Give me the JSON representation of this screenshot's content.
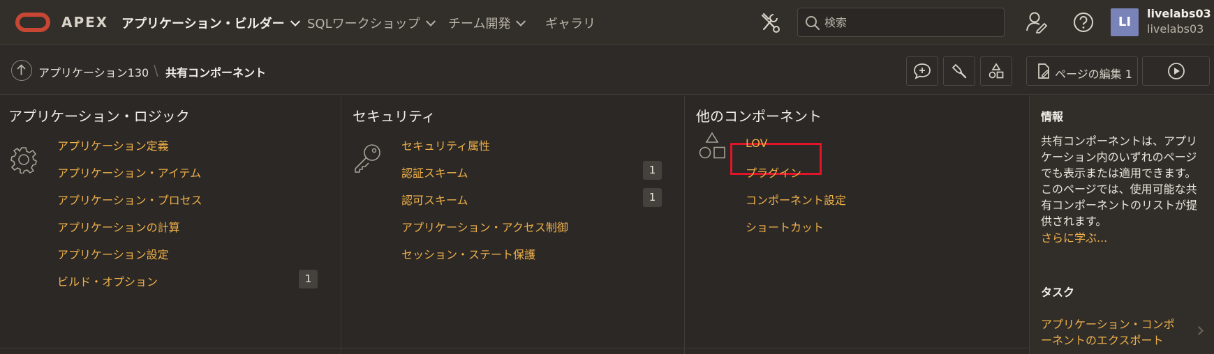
{
  "header": {
    "brand": "APEX",
    "menu": [
      {
        "label": "アプリケーション・ビルダー",
        "active": true
      },
      {
        "label": "SQLワークショップ",
        "active": false
      },
      {
        "label": "チーム開発",
        "active": false
      },
      {
        "label": "ギャラリ",
        "active": false
      }
    ],
    "search_placeholder": "検索",
    "user_initials": "LI",
    "user_name": "livelabs03",
    "user_workspace": "livelabs03"
  },
  "breadcrumb": {
    "parent": "アプリケーション130",
    "separator": "\\",
    "current": "共有コンポーネント"
  },
  "toolbar": {
    "edit_page_label": "ページの編集 1"
  },
  "sections": {
    "logic": {
      "title": "アプリケーション・ロジック",
      "items": [
        {
          "label": "アプリケーション定義",
          "badge": ""
        },
        {
          "label": "アプリケーション・アイテム",
          "badge": ""
        },
        {
          "label": "アプリケーション・プロセス",
          "badge": ""
        },
        {
          "label": "アプリケーションの計算",
          "badge": ""
        },
        {
          "label": "アプリケーション設定",
          "badge": ""
        },
        {
          "label": "ビルド・オプション",
          "badge": "1"
        }
      ]
    },
    "security": {
      "title": "セキュリティ",
      "items": [
        {
          "label": "セキュリティ属性",
          "badge": ""
        },
        {
          "label": "認証スキーム",
          "badge": "1"
        },
        {
          "label": "認可スキーム",
          "badge": "1"
        },
        {
          "label": "アプリケーション・アクセス制御",
          "badge": ""
        },
        {
          "label": "セッション・ステート保護",
          "badge": ""
        }
      ]
    },
    "other": {
      "title": "他のコンポーネント",
      "items": [
        {
          "label": "LOV",
          "badge": ""
        },
        {
          "label": "プラグイン",
          "badge": ""
        },
        {
          "label": "コンポーネント設定",
          "badge": ""
        },
        {
          "label": "ショートカット",
          "badge": ""
        }
      ]
    }
  },
  "side_panel": {
    "info_title": "情報",
    "info_lines": [
      "共有コンポーネントは、アプリ",
      "ケーション内のいずれのページ",
      "でも表示または適用できます。",
      "このページでは、使用可能な共",
      "有コンポーネントのリストが提",
      "供されます。"
    ],
    "learn_more": "さらに学ぶ...",
    "tasks_title": "タスク",
    "task_lines": [
      "アプリケーション・コンポ",
      "ーネントのエクスポート"
    ]
  },
  "colors": {
    "background": "#2b2825",
    "link": "#f0b14a",
    "brand_red": "#c74634",
    "highlight": "#e0152a",
    "avatar": "#7a83b7"
  }
}
